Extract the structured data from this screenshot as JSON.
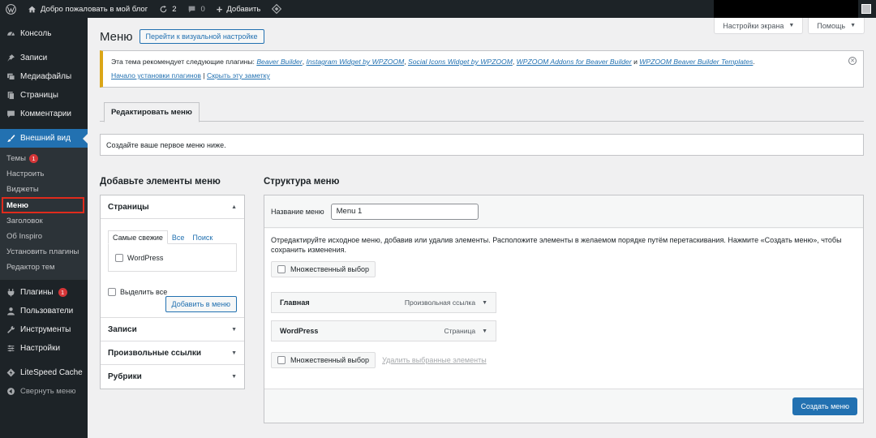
{
  "admin_bar": {
    "site_title": "Добро пожаловать в мой блог",
    "updates_count": "2",
    "comments_count": "0",
    "new_label": "Добавить"
  },
  "sidebar": {
    "items_top": [
      {
        "label": "Консоль",
        "icon": "dashboard-icon"
      },
      {
        "label": "Записи",
        "icon": "pin-icon"
      },
      {
        "label": "Медиафайлы",
        "icon": "media-icon"
      },
      {
        "label": "Страницы",
        "icon": "page-icon"
      },
      {
        "label": "Комментарии",
        "icon": "comment-icon"
      }
    ],
    "appearance": {
      "label": "Внешний вид",
      "icon": "brush-icon"
    },
    "submenu": [
      {
        "label": "Темы",
        "badge": "1"
      },
      {
        "label": "Настроить"
      },
      {
        "label": "Виджеты"
      },
      {
        "label": "Меню"
      },
      {
        "label": "Заголовок"
      },
      {
        "label": "Об Inspiro"
      },
      {
        "label": "Установить плагины"
      },
      {
        "label": "Редактор тем"
      }
    ],
    "items_bottom": [
      {
        "label": "Плагины",
        "badge": "1",
        "icon": "plugin-icon"
      },
      {
        "label": "Пользователи",
        "icon": "users-icon"
      },
      {
        "label": "Инструменты",
        "icon": "wrench-icon"
      },
      {
        "label": "Настройки",
        "icon": "settings-icon"
      },
      {
        "label": "LiteSpeed Cache",
        "icon": "litespeed-icon"
      },
      {
        "label": "Свернуть меню",
        "icon": "collapse-icon"
      }
    ]
  },
  "screen_options": {
    "label": "Настройки экрана",
    "help": "Помощь"
  },
  "header": {
    "title": "Меню",
    "customizer_button": "Перейти к визуальной настройке"
  },
  "notice": {
    "prefix": "Эта тема рекомендует следующие плагины: ",
    "plugins": [
      "Beaver Builder",
      "Instagram Widget by WPZOOM",
      "Social Icons Widget by WPZOOM",
      "WPZOOM Addons for Beaver Builder",
      "WPZOOM Beaver Builder Templates"
    ],
    "sep": ", ",
    "and": " и ",
    "end": ".",
    "install_link": "Начало установки плагинов",
    "divider": " | ",
    "hide_link": "Скрыть эту заметку"
  },
  "tab": {
    "edit_menu": "Редактировать меню"
  },
  "info": {
    "text": "Создайте ваше первое меню ниже."
  },
  "add_items": {
    "title": "Добавьте элементы меню",
    "pages": {
      "label": "Страницы",
      "tabs": [
        "Самые свежие",
        "Все",
        "Поиск"
      ],
      "item": "WordPress",
      "select_all": "Выделить все",
      "add_button": "Добавить в меню"
    },
    "sections": [
      "Записи",
      "Произвольные ссылки",
      "Рубрики"
    ]
  },
  "structure": {
    "title": "Структура меню",
    "name_label": "Название меню",
    "name_value": "Menu 1",
    "description": "Отредактируйте исходное меню, добавив или удалив элементы. Расположите элементы в желаемом порядке путём перетаскивания. Нажмите «Создать меню», чтобы сохранить изменения.",
    "bulk_select": "Множественный выбор",
    "items": [
      {
        "title": "Главная",
        "type": "Произвольная ссылка"
      },
      {
        "title": "WordPress",
        "type": "Страница"
      }
    ],
    "remove_selected": "Удалить выбранные элементы",
    "create_button": "Создать меню"
  },
  "colors": {
    "accent": "#2271b1",
    "sidebar": "#1d2327",
    "notice_border": "#dba617",
    "highlight": "#e02b1c"
  }
}
